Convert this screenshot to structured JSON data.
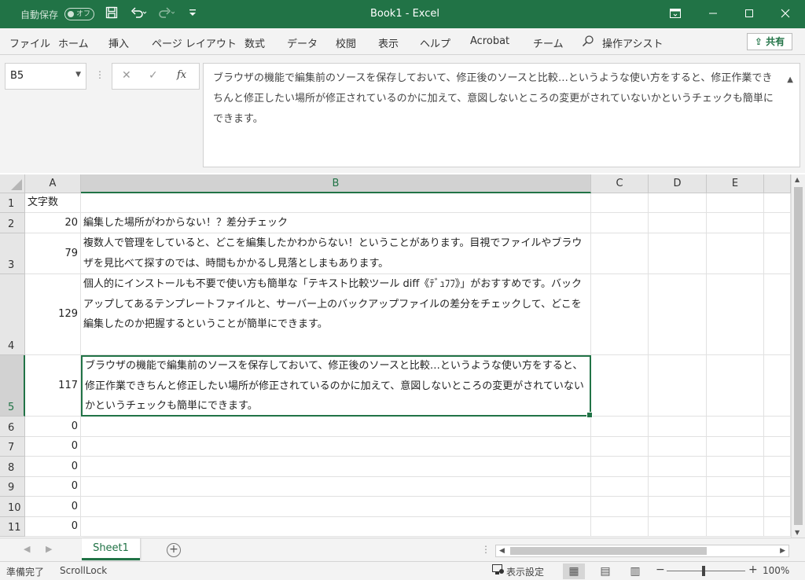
{
  "titlebar": {
    "autosave": "自動保存",
    "autosave_state": "オフ",
    "title": "Book1 - Excel",
    "icons": [
      "save-icon",
      "undo-icon",
      "redo-icon",
      "customize-qat-icon",
      "ribbon-display-icon",
      "minimize-icon",
      "maximize-icon",
      "close-icon"
    ]
  },
  "ribbon": {
    "tabs": [
      "ファイル",
      "ホーム",
      "挿入",
      "ページ レイアウト",
      "数式",
      "データ",
      "校閲",
      "表示",
      "ヘルプ",
      "Acrobat",
      "チーム"
    ],
    "tell_me": "操作アシスト",
    "share": "共有"
  },
  "formula_bar": {
    "name_box": "B5",
    "fx": "fx",
    "content": "ブラウザの機能で編集前のソースを保存しておいて、修正後のソースと比較…というような使い方をすると、修正作業できちんと修正したい場所が修正されているのかに加えて、意図しないところの変更がされていないかというチェックも簡単にできます。"
  },
  "grid": {
    "columns": [
      "A",
      "B",
      "C",
      "D",
      "E"
    ],
    "selected_column": "B",
    "selected_row": "5",
    "rows": [
      {
        "num": "1",
        "a": "文字数",
        "b": ""
      },
      {
        "num": "2",
        "a": "20",
        "b": "編集した場所がわからない！？差分チェック"
      },
      {
        "num": "3",
        "a": "79",
        "b": "複数人で管理をしていると、どこを編集したかわからない！ということがあります。目視でファイルやブラウザを見比べて探すのでは、時間もかかるし見落としまもあります。"
      },
      {
        "num": "4",
        "a": "129",
        "b": "個人的にインストールも不要で使い方も簡単な「テキスト比較ツール diff《ﾃﾞｭﾌﾌ》」がおすすめです。バックアップしてあるテンプレートファイルと、サーバー上のバックアップファイルの差分をチェックして、どこを編集したのか把握するということが簡単にできます。"
      },
      {
        "num": "5",
        "a": "117",
        "b": "ブラウザの機能で編集前のソースを保存しておいて、修正後のソースと比較…というような使い方をすると、修正作業できちんと修正したい場所が修正されているのかに加えて、意図しないところの変更がされていないかというチェックも簡単にできます。"
      },
      {
        "num": "6",
        "a": "0",
        "b": ""
      },
      {
        "num": "7",
        "a": "0",
        "b": ""
      },
      {
        "num": "8",
        "a": "0",
        "b": ""
      },
      {
        "num": "9",
        "a": "0",
        "b": ""
      },
      {
        "num": "10",
        "a": "0",
        "b": ""
      },
      {
        "num": "11",
        "a": "0",
        "b": ""
      }
    ]
  },
  "sheets": {
    "active": "Sheet1",
    "add_icon": "plus-circle-icon"
  },
  "statusbar": {
    "ready": "準備完了",
    "scroll_lock": "ScrollLock",
    "display_settings": "表示設定",
    "zoom": "100%",
    "zoom_minus": "−",
    "zoom_plus": "+"
  },
  "colors": {
    "excel_green": "#217346",
    "ribbon_bg": "#f3f3f3",
    "header_bg": "#e6e6e6"
  }
}
